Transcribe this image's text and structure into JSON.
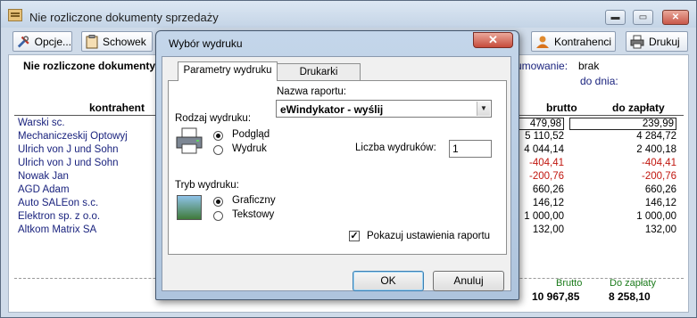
{
  "main": {
    "title": "Nie rozliczone dokumenty sprzedaży",
    "toolbar": {
      "options_label": "Opcje...",
      "clipboard_label": "Schowek",
      "contractors_label": "Kontrahenci",
      "print_label": "Drukuj"
    },
    "report": {
      "title": "Nie rozliczone dokumenty",
      "doc_note_label": "umowanie:",
      "doc_note_value": "brak",
      "to_date_label": "do dnia:",
      "columns": {
        "contractor": "kontrahent",
        "gross": "brutto",
        "to_pay": "do zapłaty"
      },
      "rows": [
        {
          "name": "Warski sc.",
          "gross": "479,98",
          "to_pay": "239,99"
        },
        {
          "name": "Mechaniczeskij Optowyj",
          "gross": "5 110,52",
          "to_pay": "4 284,72"
        },
        {
          "name": "Ulrich von J und Sohn",
          "gross": "4 044,14",
          "to_pay": "2 400,18"
        },
        {
          "name": "Ulrich von J und Sohn",
          "gross": "-404,41",
          "to_pay": "-404,41"
        },
        {
          "name": "Nowak Jan",
          "gross": "-200,76",
          "to_pay": "-200,76"
        },
        {
          "name": "AGD Adam",
          "gross": "660,26",
          "to_pay": "660,26"
        },
        {
          "name": "Auto SALEon s.c.",
          "gross": "146,12",
          "to_pay": "146,12"
        },
        {
          "name": "Elektron sp. z o.o.",
          "gross": "1 000,00",
          "to_pay": "1 000,00"
        },
        {
          "name": "Altkom Matrix SA",
          "gross": "132,00",
          "to_pay": "132,00"
        }
      ],
      "footer": {
        "gross_label": "Brutto",
        "to_pay_label": "Do zapłaty",
        "gross_total": "10 967,85",
        "to_pay_total": "8 258,10"
      }
    }
  },
  "dialog": {
    "title": "Wybór wydruku",
    "close_glyph": "✕",
    "tabs": [
      "Parametry wydruku",
      "Drukarki"
    ],
    "report_name_label": "Nazwa raportu:",
    "report_name_value": "eWindykator - wyślij",
    "print_type_label": "Rodzaj wydruku:",
    "print_type_options": [
      "Podgląd",
      "Wydruk"
    ],
    "copies_label": "Liczba wydruków:",
    "copies_value": "1",
    "print_mode_label": "Tryb wydruku:",
    "print_mode_options": [
      "Graficzny",
      "Tekstowy"
    ],
    "show_settings_label": "Pokazuj ustawienia raportu",
    "show_settings_checked": true,
    "ok_label": "OK",
    "cancel_label": "Anuluj"
  },
  "colors": {
    "negative": "#c1170f",
    "name_text": "#1a237e",
    "footer_label": "#1a7a1a"
  }
}
